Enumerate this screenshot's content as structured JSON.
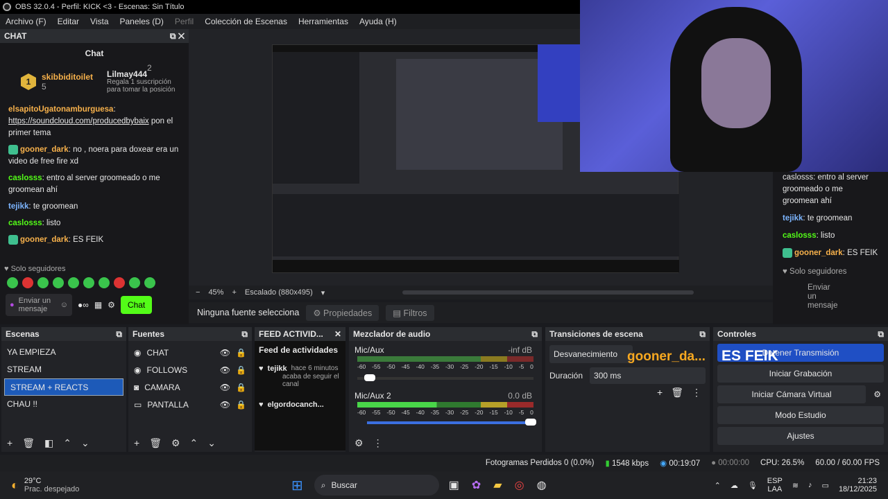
{
  "window": {
    "title": "OBS 32.0.4 - Perfil: KICK <3 - Escenas: Sin Título"
  },
  "menu": [
    "Archivo (F)",
    "Editar",
    "Vista",
    "Paneles (D)",
    "Perfil",
    "Colección de Escenas",
    "Herramientas",
    "Ayuda (H)"
  ],
  "chat": {
    "dock_title": "CHAT",
    "heading": "Chat",
    "gift_user1": "skibbiditoilet",
    "gift_count1": "5",
    "gift_user2": "Lilmay444",
    "gift_count2": "2",
    "gift_text": "Regala 1 suscripción para tomar la posición",
    "msg0_user": "elsapitoUgatonamburguesa",
    "msg0_link": "https://soundcloud.com/producedbybaix",
    "msg0_text": "pon el primer tema",
    "msg1_user": "gooner_dark",
    "msg1_text": "no , noera para doxear era un video de free fire xd",
    "msg2_user": "caslosss",
    "msg2_text": "entro al server groomeado o me groomean ahí",
    "msg3_user": "tejikk",
    "msg3_text": "te groomean",
    "msg4_user": "caslosss",
    "msg4_text": "listo",
    "msg5_user": "gooner_dark",
    "msg5_text": "ES FEIK",
    "followers_only": "Solo seguidores",
    "input_placeholder": "Enviar un mensaje",
    "send_button": "Chat"
  },
  "right_chat": {
    "l1": "caslosss: entro al server",
    "l2": "groomeado o me",
    "l3": "groomean ahí",
    "tejikk": "tejikk",
    "tejikk_text": "te groomean",
    "caslosss": "caslosss",
    "caslosss_text": "listo",
    "gooner": "gooner_dark",
    "gooner_text": "ES FEIK",
    "followers": "Solo seguidores",
    "input": "Enviar un mensaje"
  },
  "preview": {
    "zoom": "45%",
    "scale": "Escalado (880x495)",
    "no_source": "Ninguna fuente selecciona",
    "properties": "Propiedades",
    "filters": "Filtros"
  },
  "scenes": {
    "title": "Escenas",
    "items": [
      "YA EMPIEZA",
      "STREAM",
      "STREAM + REACTS",
      "CHAU !!"
    ],
    "selected": "STREAM + REACTS"
  },
  "sources": {
    "title": "Fuentes",
    "items": [
      "CHAT",
      "FOLLOWS",
      "CAMARA",
      "PANTALLA"
    ]
  },
  "feed": {
    "title": "FEED ACTIVID...",
    "heading": "Feed de actividades",
    "user1": "tejikk",
    "time1": "hace 6 minutos",
    "action1": "acaba de seguir el canal",
    "user2": "elgordocanch..."
  },
  "mixer": {
    "title": "Mezclador de audio",
    "ch1_name": "Mic/Aux",
    "ch1_level": "-inf dB",
    "ch2_name": "Mic/Aux 2",
    "ch2_level": "0.0 dB",
    "ticks": [
      "-60",
      "-55",
      "-50",
      "-45",
      "-40",
      "-35",
      "-30",
      "-25",
      "-20",
      "-15",
      "-10",
      "-5",
      "0"
    ]
  },
  "transitions": {
    "title": "Transiciones de escena",
    "type": "Desvanecimiento",
    "duration_label": "Duración",
    "duration": "300 ms"
  },
  "controls": {
    "title": "Controles",
    "start_stream": "Detener Transmisión",
    "record": "Iniciar Grabación",
    "virtualcam": "Iniciar Cámara Virtual",
    "studio": "Modo Estudio",
    "settings": "Ajustes"
  },
  "overlay": {
    "gooner": "gooner_da...",
    "es_feik": "ES FEIK"
  },
  "status": {
    "dropped": "Fotogramas Perdidos 0 (0.0%)",
    "bitrate": "1548 kbps",
    "stream_time": "00:19:07",
    "rec_time": "00:00:00",
    "cpu": "CPU: 26.5%",
    "fps": "60.00 / 60.00 FPS"
  },
  "taskbar": {
    "temp": "29°C",
    "weather": "Prac. despejado",
    "search": "Buscar",
    "lang1": "ESP",
    "lang2": "LAA",
    "time": "21:23",
    "date": "18/12/2025"
  },
  "colors": {
    "accent": "#1d5ab8",
    "kick_green": "#53fc18"
  }
}
